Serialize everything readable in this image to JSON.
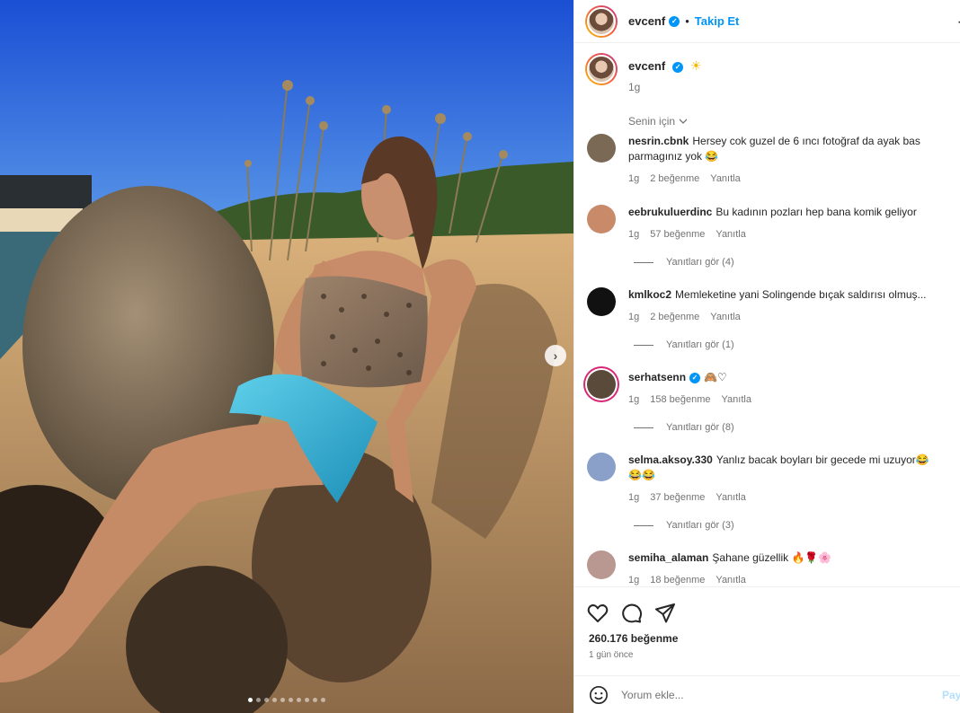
{
  "header": {
    "username": "evcenf",
    "separator": "•",
    "follow_label": "Takip Et"
  },
  "caption": {
    "username": "evcenf",
    "time": "1g"
  },
  "sort_label": "Senin için",
  "comments": [
    {
      "user": "nesrin.cbnk",
      "text": "Hersey cok guzel de 6 ıncı fotoğraf da ayak bas parmagınız yok 😂",
      "time": "1g",
      "likes": "2 beğenme",
      "reply": "Yanıtla",
      "avatar_color": "#7a6a55"
    },
    {
      "user": "eebrukuluerdinc",
      "text": "Bu kadının pozları hep bana komik geliyor",
      "time": "1g",
      "likes": "57 beğenme",
      "reply": "Yanıtla",
      "view_replies": "Yanıtları gör (4)",
      "avatar_color": "#c98a6a"
    },
    {
      "user": "kmlkoc2",
      "text": "Memleketine yani Solingende bıçak saldırısı olmuş...",
      "time": "1g",
      "likes": "2 beğenme",
      "reply": "Yanıtla",
      "view_replies": "Yanıtları gör (1)",
      "avatar_color": "#111111"
    },
    {
      "user": "serhatsenn",
      "text": "🙈♡",
      "time": "1g",
      "likes": "158 beğenme",
      "reply": "Yanıtla",
      "view_replies": "Yanıtları gör (8)",
      "avatar_color": "#5a4a3a"
    },
    {
      "user": "selma.aksoy.330",
      "text": "Yanlız bacak boyları bir gecede mi uzuyor😂😂😂",
      "time": "1g",
      "likes": "37 beğenme",
      "reply": "Yanıtla",
      "view_replies": "Yanıtları gör (3)",
      "avatar_color": "#8aa0c8"
    },
    {
      "user": "semiha_alaman",
      "text": "Şahane güzellik 🔥🌹🌸",
      "time": "1g",
      "likes": "18 beğenme",
      "reply": "Yanıtla",
      "avatar_color": "#b89890"
    }
  ],
  "likes_count": "260.176 beğenme",
  "posted_ago": "1 gün önce",
  "comment_input": {
    "placeholder": "Yorum ekle..."
  },
  "post_label": "Paylaş",
  "carousel": {
    "slides": 10,
    "active_index": 0
  },
  "colors": {
    "accent": "#0095f6",
    "muted": "#737373",
    "sky": "#2a63d8"
  }
}
